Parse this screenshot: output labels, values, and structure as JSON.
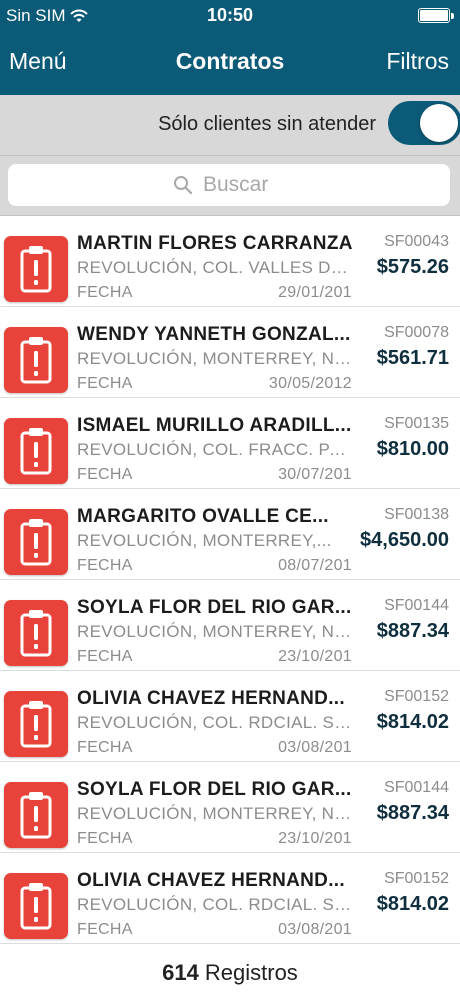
{
  "status_bar": {
    "carrier": "Sin SIM",
    "time": "10:50"
  },
  "nav": {
    "menu_label": "Menú",
    "title": "Contratos",
    "filters_label": "Filtros"
  },
  "filter": {
    "label": "Sólo clientes sin atender",
    "toggle_on": true
  },
  "search": {
    "placeholder": "Buscar"
  },
  "contracts": [
    {
      "name": "MARTIN FLORES CARRANZA",
      "address": "REVOLUCIÓN, COL. VALLES DE...",
      "fecha_label": "FECHA",
      "date": "29/01/201",
      "code": "SF00043",
      "amount": "$575.26"
    },
    {
      "name": "WENDY YANNETH GONZAL...",
      "address": "REVOLUCIÓN, MONTERREY, N.L....",
      "fecha_label": "FECHA",
      "date": "30/05/2012",
      "code": "SF00078",
      "amount": "$561.71"
    },
    {
      "name": "ISMAEL MURILLO ARADILL...",
      "address": "REVOLUCIÓN, COL. FRACC. PAS...",
      "fecha_label": "FECHA",
      "date": "30/07/201",
      "code": "SF00135",
      "amount": "$810.00"
    },
    {
      "name": "MARGARITO OVALLE CE...",
      "address": "REVOLUCIÓN, MONTERREY,...",
      "fecha_label": "FECHA",
      "date": "08/07/201",
      "code": "SF00138",
      "amount": "$4,650.00"
    },
    {
      "name": "SOYLA FLOR DEL RIO GAR...",
      "address": "REVOLUCIÓN, MONTERREY, N.L...",
      "fecha_label": "FECHA",
      "date": "23/10/201",
      "code": "SF00144",
      "amount": "$887.34"
    },
    {
      "name": "OLIVIA CHAVEZ HERNAND...",
      "address": "REVOLUCIÓN, COL. RDCIAL. SA...",
      "fecha_label": "FECHA",
      "date": "03/08/201",
      "code": "SF00152",
      "amount": "$814.02"
    },
    {
      "name": "SOYLA FLOR DEL RIO GAR...",
      "address": "REVOLUCIÓN, MONTERREY, N.L...",
      "fecha_label": "FECHA",
      "date": "23/10/201",
      "code": "SF00144",
      "amount": "$887.34"
    },
    {
      "name": "OLIVIA CHAVEZ HERNAND...",
      "address": "REVOLUCIÓN, COL. RDCIAL. SA...",
      "fecha_label": "FECHA",
      "date": "03/08/201",
      "code": "SF00152",
      "amount": "$814.02"
    }
  ],
  "footer": {
    "count": "614",
    "label": "Registros"
  },
  "colors": {
    "header": "#0b5a78",
    "alert_icon": "#e8433b",
    "amount": "#0f2e3e"
  },
  "icons": {
    "row_icon": "clipboard-alert-icon",
    "search": "search-icon",
    "wifi": "wifi-icon",
    "battery": "battery-icon"
  }
}
